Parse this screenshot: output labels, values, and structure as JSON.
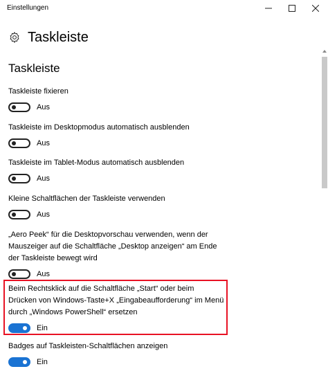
{
  "window": {
    "title": "Einstellungen",
    "buttons": {
      "minimize": "–",
      "maximize": "☐",
      "close": "✕"
    }
  },
  "page": {
    "title": "Taskleiste",
    "icon": "gear-icon"
  },
  "section": {
    "title": "Taskleiste"
  },
  "settings": [
    {
      "label": "Taskleiste fixieren",
      "state": "Aus",
      "on": false
    },
    {
      "label": "Taskleiste im Desktopmodus automatisch ausblenden",
      "state": "Aus",
      "on": false
    },
    {
      "label": "Taskleiste im Tablet-Modus automatisch ausblenden",
      "state": "Aus",
      "on": false
    },
    {
      "label": "Kleine Schaltflächen der Taskleiste verwenden",
      "state": "Aus",
      "on": false
    },
    {
      "label": "„Aero Peek“ für die Desktopvorschau verwenden, wenn der Mauszeiger auf die Schaltfläche „Desktop anzeigen“ am Ende der Taskleiste bewegt wird",
      "state": "Aus",
      "on": false
    },
    {
      "label": "Beim Rechtsklick auf die Schaltfläche „Start“ oder beim Drücken von Windows-Taste+X „Eingabeaufforderung“ im Menü durch „Windows PowerShell“ ersetzen",
      "state": "Ein",
      "on": true
    },
    {
      "label": "Badges auf Taskleisten-Schaltflächen anzeigen",
      "state": "Ein",
      "on": true
    }
  ],
  "colors": {
    "toggle_on": "#1a73d3",
    "highlight": "#e81123"
  }
}
